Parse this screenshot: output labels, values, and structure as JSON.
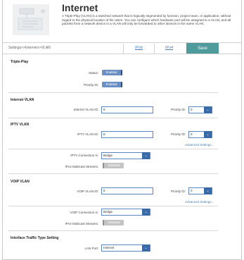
{
  "header": {
    "title": "Internet",
    "description": "A Triple-Play (VLAN) is a switched network that is logically segmented by function, project team, or application, without regard to the physical location of the users. You can configure which hardware port will be assigned to a VLAN, and all packets from a network device in a VLAN will only be forwarded to other devices in the same VLAN."
  },
  "breadcrumb": "Settings>>Internet>>VLAN",
  "tabs": {
    "ipv6": "IPv6",
    "ipv4": "IPv4"
  },
  "save_label": "Save",
  "triple_play": {
    "title": "Triple-Play",
    "status_label": "Status:",
    "status_value": "Enabled",
    "priority_id_label": "Priority ID:",
    "priority_id_value": "Enabled"
  },
  "internet_vlan": {
    "title": "Internet VLAN",
    "vlan_id_label": "Internet VLAN ID:",
    "vlan_id_value": "8",
    "priority_label": "Priority ID:",
    "priority_value": "0"
  },
  "iptv_vlan": {
    "title": "IPTV VLAN",
    "vlan_id_label": "IPTV VLAN ID:",
    "vlan_id_value": "8",
    "priority_label": "Priority ID:",
    "priority_value": "0",
    "advanced": "Advanced Settings...",
    "connection_label": "IPTV Connection is:",
    "connection_value": "Bridge",
    "multicast_label": "IPv4 Multicast Streams:",
    "multicast_value": "Disabled"
  },
  "voip_vlan": {
    "title": "VOIP VLAN",
    "vlan_id_label": "VOIP VLAN ID:",
    "vlan_id_value": "8",
    "priority_label": "Priority ID:",
    "priority_value": "0",
    "advanced": "Advanced Settings...",
    "connection_label": "VOIP Connection is:",
    "connection_value": "Bridge",
    "multicast_label": "IPv4 Multicast Streams:",
    "multicast_value": "Disabled"
  },
  "traffic_type": {
    "title": "Interface Traffic Type Setting",
    "lan_port_label": "LAN Port:",
    "lan_port_value": "Internet"
  },
  "colors": {
    "save": "#4f9a9a",
    "toggle_on": "#6c90c4",
    "link": "#4a7fb5"
  }
}
